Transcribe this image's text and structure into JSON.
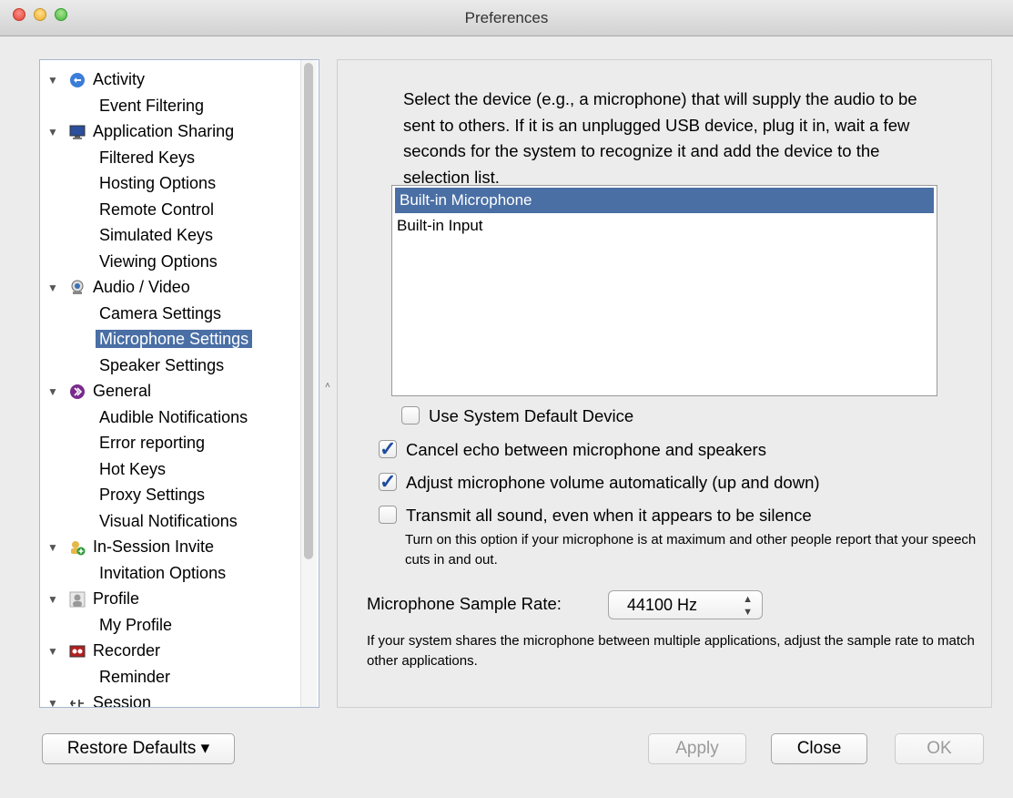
{
  "window": {
    "title": "Preferences"
  },
  "tree": [
    {
      "label": "Activity",
      "type": "category",
      "icon": "activity-icon"
    },
    {
      "label": "Event Filtering",
      "type": "leaf"
    },
    {
      "label": "Application Sharing",
      "type": "category",
      "icon": "monitor-icon"
    },
    {
      "label": "Filtered Keys",
      "type": "leaf"
    },
    {
      "label": "Hosting Options",
      "type": "leaf"
    },
    {
      "label": "Remote Control",
      "type": "leaf"
    },
    {
      "label": "Simulated Keys",
      "type": "leaf"
    },
    {
      "label": "Viewing Options",
      "type": "leaf"
    },
    {
      "label": "Audio / Video",
      "type": "category",
      "icon": "webcam-icon"
    },
    {
      "label": "Camera Settings",
      "type": "leaf"
    },
    {
      "label": "Microphone Settings",
      "type": "leaf",
      "selected": true
    },
    {
      "label": "Speaker Settings",
      "type": "leaf"
    },
    {
      "label": "General",
      "type": "category",
      "icon": "general-icon"
    },
    {
      "label": "Audible Notifications",
      "type": "leaf"
    },
    {
      "label": "Error reporting",
      "type": "leaf"
    },
    {
      "label": "Hot Keys",
      "type": "leaf"
    },
    {
      "label": "Proxy Settings",
      "type": "leaf"
    },
    {
      "label": "Visual Notifications",
      "type": "leaf"
    },
    {
      "label": "In-Session Invite",
      "type": "category",
      "icon": "invite-icon"
    },
    {
      "label": "Invitation Options",
      "type": "leaf"
    },
    {
      "label": "Profile",
      "type": "category",
      "icon": "profile-icon"
    },
    {
      "label": "My Profile",
      "type": "leaf"
    },
    {
      "label": "Recorder",
      "type": "category",
      "icon": "recorder-icon"
    },
    {
      "label": "Reminder",
      "type": "leaf"
    },
    {
      "label": "Session",
      "type": "category",
      "icon": "session-icon"
    }
  ],
  "main": {
    "description": "Select the device (e.g., a microphone) that will supply the audio to be sent to others.  If it is an unplugged USB device, plug it in, wait a few seconds for the system to recognize it and add the device to the selection list.",
    "devices": [
      {
        "label": "Built-in Microphone",
        "selected": true
      },
      {
        "label": "Built-in Input",
        "selected": false
      }
    ],
    "use_default_label": "Use System Default Device",
    "use_default_checked": false,
    "cancel_echo_label": "Cancel echo between microphone and speakers",
    "cancel_echo_checked": true,
    "adjust_volume_label": "Adjust microphone volume automatically (up and down)",
    "adjust_volume_checked": true,
    "transmit_all_label": "Transmit all sound, even when it appears to be silence",
    "transmit_all_checked": false,
    "transmit_hint": "Turn on this option if your microphone is at maximum and other people report that your speech cuts in and out.",
    "sample_rate_label": "Microphone Sample Rate:",
    "sample_rate_value": "44100 Hz",
    "sample_rate_hint": "If your system shares the microphone between multiple applications, adjust the sample rate to match other applications."
  },
  "buttons": {
    "restore_defaults": "Restore Defaults",
    "apply": "Apply",
    "close": "Close",
    "ok": "OK"
  }
}
